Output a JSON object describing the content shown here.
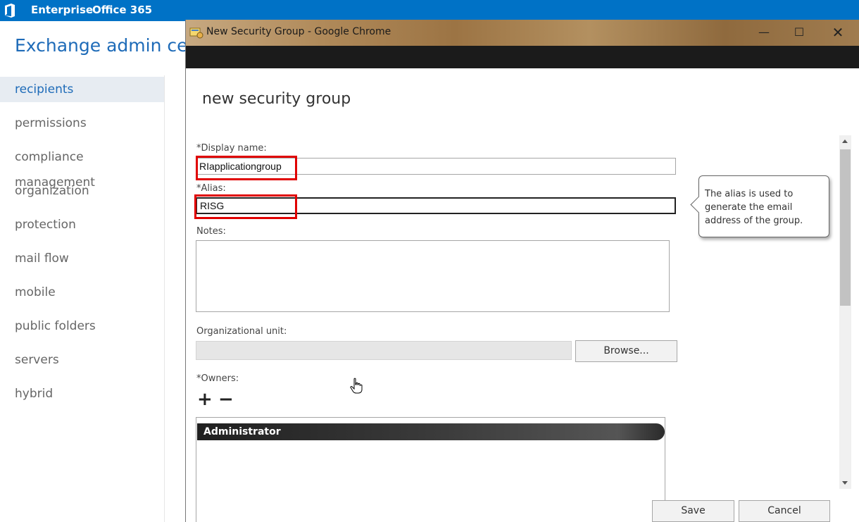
{
  "topbar": {
    "enterprise": "Enterprise",
    "office365": "Office 365",
    "bg": "#0072c6"
  },
  "eac": {
    "title": "Exchange admin cent"
  },
  "nav": [
    "recipients",
    "permissions",
    "compliance management",
    "organization",
    "protection",
    "mail flow",
    "mobile",
    "public folders",
    "servers",
    "hybrid"
  ],
  "window": {
    "title": "New Security Group  - Google Chrome"
  },
  "dialog": {
    "title": "new security group",
    "display_name": {
      "label": "*Display name:",
      "value": "RIapplicationgroup"
    },
    "alias": {
      "label": "*Alias:",
      "value": "RISG"
    },
    "notes": {
      "label": "Notes:"
    },
    "ou": {
      "label": "Organizational unit:",
      "browse": "Browse..."
    },
    "owners": {
      "label": "*Owners:",
      "add": "+",
      "remove": "−",
      "items": [
        "Administrator"
      ]
    },
    "tooltip": "The alias is used to generate the email address of the group.",
    "save": "Save",
    "cancel": "Cancel"
  }
}
